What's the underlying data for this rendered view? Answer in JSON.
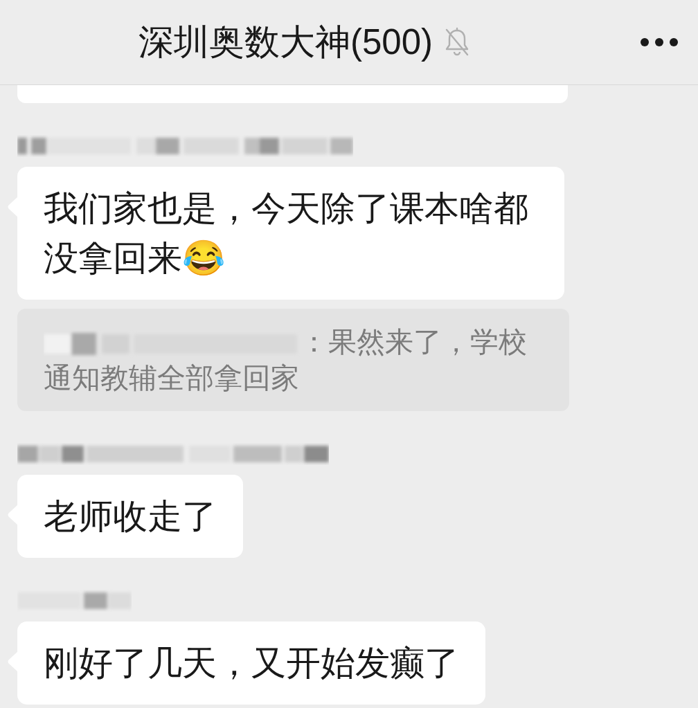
{
  "header": {
    "title": "深圳奥数大神(500)",
    "muted": true
  },
  "messages": [
    {
      "kind": "partial"
    },
    {
      "kind": "text",
      "sender_blurred": true,
      "text": "我们家也是，今天除了课本啥都没拿回来😂",
      "quote": {
        "author_blurred": true,
        "text": "：果然来了，学校通知教辅全部拿回家"
      }
    },
    {
      "kind": "text",
      "sender_blurred": true,
      "text": "老师收走了"
    },
    {
      "kind": "text",
      "sender_blurred": true,
      "text": "刚好了几天，又开始发癫了"
    }
  ]
}
